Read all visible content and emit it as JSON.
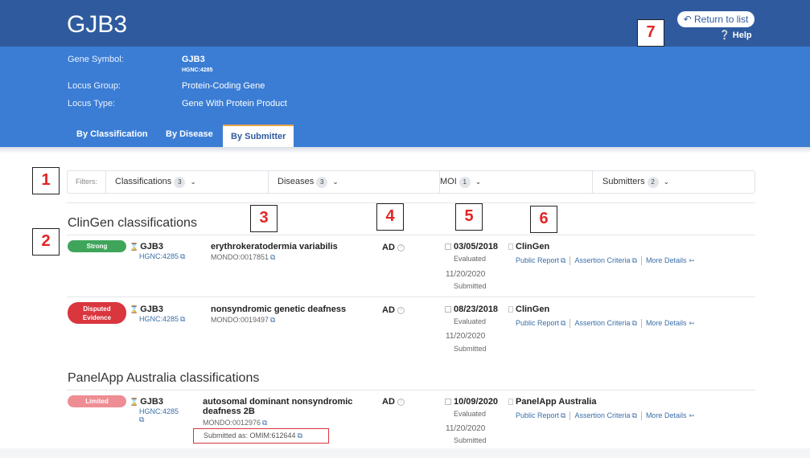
{
  "header": {
    "title": "GJB3",
    "return_label": "Return to list",
    "help_label": "Help"
  },
  "info": {
    "gene_symbol_label": "Gene Symbol:",
    "gene_symbol": "GJB3",
    "hgnc": "HGNC:4285",
    "locus_group_label": "Locus Group:",
    "locus_group": "Protein-Coding Gene",
    "locus_type_label": "Locus Type:",
    "locus_type": "Gene With Protein Product"
  },
  "tabs": [
    {
      "label": "By Classification"
    },
    {
      "label": "By Disease"
    },
    {
      "label": "By Submitter",
      "active": true
    }
  ],
  "filters": {
    "label": "Filters:",
    "items": [
      {
        "label": "Classifications",
        "count": "3"
      },
      {
        "label": "Diseases",
        "count": "3"
      },
      {
        "label": "MOI",
        "count": "1"
      },
      {
        "label": "Submitters",
        "count": "2"
      }
    ]
  },
  "sections": [
    {
      "title": "ClinGen classifications",
      "rows": [
        {
          "badge": "Strong",
          "gene": "GJB3",
          "hgnc": "HGNC:4285",
          "disease": "erythrokeratodermia variabilis",
          "mondo": "MONDO:0017851",
          "moi": "AD",
          "evaluated_date": "03/05/2018",
          "evaluated_label": "Evaluated",
          "submitted_date": "11/20/2020",
          "submitted_label": "Submitted",
          "submitter": "ClinGen",
          "links": [
            "Public Report",
            "Assertion Criteria",
            "More Details"
          ]
        },
        {
          "badge_line1": "Disputed",
          "badge_line2": "Evidence",
          "gene": "GJB3",
          "hgnc": "HGNC:4285",
          "disease": "nonsyndromic genetic deafness",
          "mondo": "MONDO:0019497",
          "moi": "AD",
          "evaluated_date": "08/23/2018",
          "evaluated_label": "Evaluated",
          "submitted_date": "11/20/2020",
          "submitted_label": "Submitted",
          "submitter": "ClinGen",
          "links": [
            "Public Report",
            "Assertion Criteria",
            "More Details"
          ]
        }
      ]
    },
    {
      "title": "PanelApp Australia classifications",
      "rows": [
        {
          "badge": "Limited",
          "gene": "GJB3",
          "hgnc_line1": "HGNC:4285",
          "disease_line1": "autosomal dominant nonsyndromic",
          "disease_line2": "deafness 2B",
          "mondo": "MONDO:0012976",
          "submitted_as": "Submitted as: OMIM:612644",
          "moi": "AD",
          "evaluated_date": "10/09/2020",
          "evaluated_label": "Evaluated",
          "submitted_date": "11/20/2020",
          "submitted_label": "Submitted",
          "submitter": "PanelApp Australia",
          "links": [
            "Public Report",
            "Assertion Criteria",
            "More Details"
          ]
        }
      ]
    }
  ],
  "annotations": [
    "1",
    "2",
    "3",
    "4",
    "5",
    "6",
    "7"
  ],
  "colors": {
    "header_dark": "#2f5b9e",
    "header_light": "#3b7dd4",
    "strong": "#3fa55b",
    "disputed": "#d9363e",
    "limited": "#ee8d93",
    "annotation_text": "#e32424"
  }
}
